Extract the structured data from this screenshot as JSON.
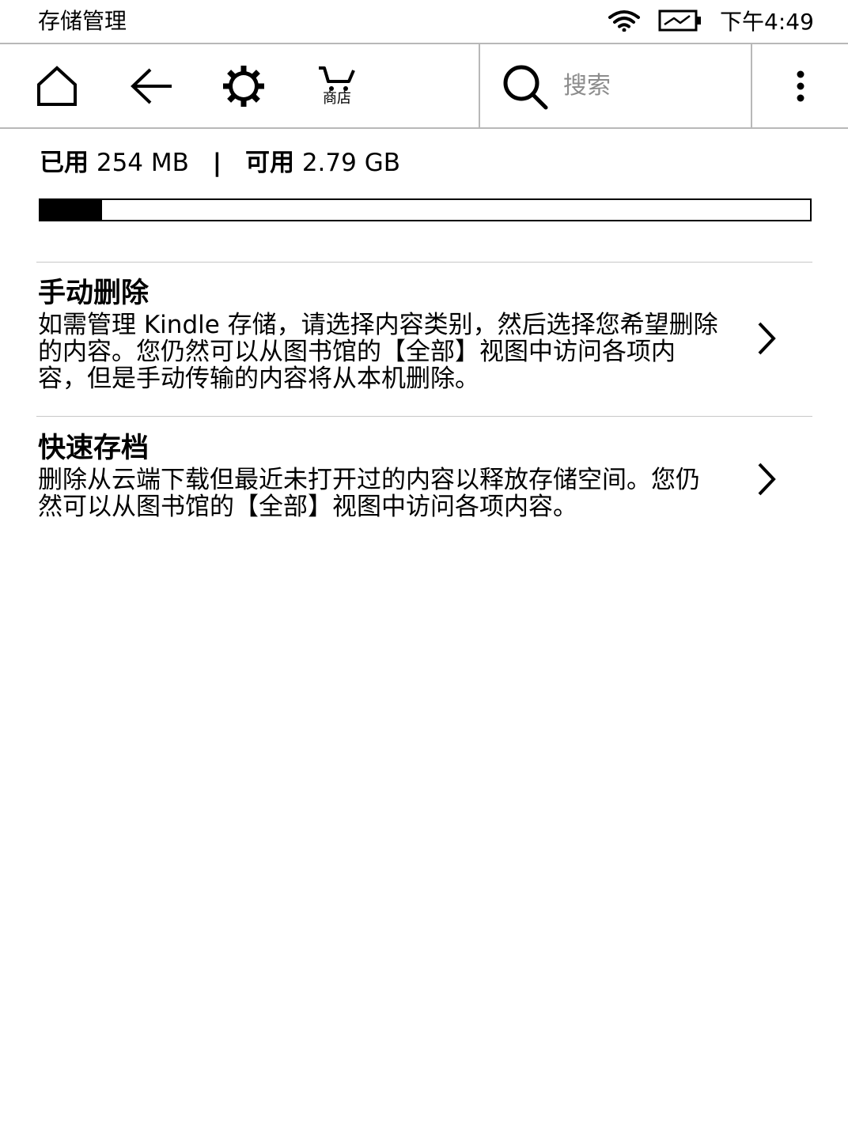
{
  "status_bar": {
    "title": "存储管理",
    "time": "下午4:49",
    "wifi_icon": "wifi-icon",
    "battery_icon": "battery-charging-icon"
  },
  "toolbar": {
    "home_icon": "home-icon",
    "back_icon": "back-arrow-icon",
    "settings_icon": "settings-gear-icon",
    "store_icon": "shopping-cart-icon",
    "store_label": "商店",
    "search_placeholder": "搜索",
    "menu_icon": "more-vertical-icon"
  },
  "storage": {
    "used_label": "已用",
    "used_value": "254 MB",
    "separator": "|",
    "available_label": "可用",
    "available_value": "2.79 GB",
    "used_fraction": 0.08
  },
  "options": [
    {
      "title": "手动删除",
      "description": "如需管理 Kindle 存储，请选择内容类别，然后选择您希望删除的内容。您仍然可以从图书馆的【全部】视图中访问各项内容，但是手动传输的内容将从本机删除。"
    },
    {
      "title": "快速存档",
      "description": "删除从云端下载但最近未打开过的内容以释放存储空间。您仍然可以从图书馆的【全部】视图中访问各项内容。"
    }
  ]
}
